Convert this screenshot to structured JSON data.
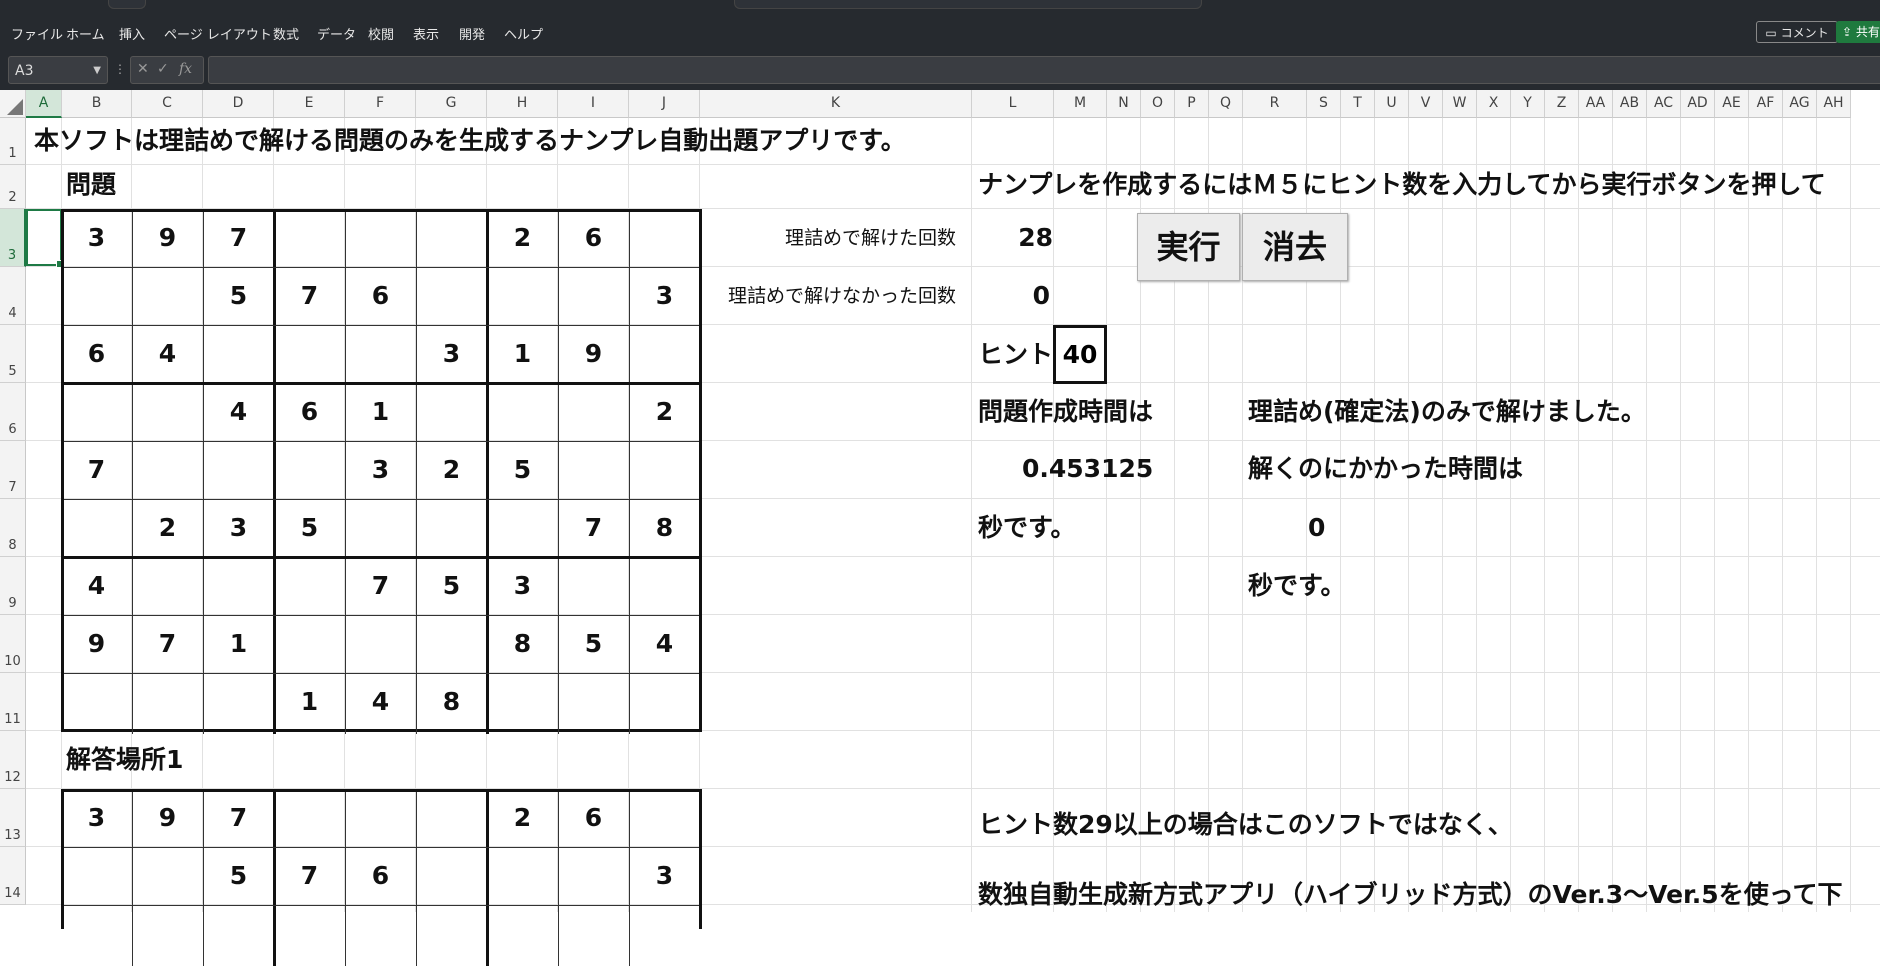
{
  "ribbon": {
    "tabs": [
      "ファイル",
      "ホーム",
      "挿入",
      "ページ レイアウト",
      "数式",
      "データ",
      "校閲",
      "表示",
      "開発",
      "ヘルプ"
    ],
    "comment_label": "コメント",
    "share_label": "共有"
  },
  "formula_bar": {
    "name_box": "A3",
    "formula": ""
  },
  "columns": [
    "A",
    "B",
    "C",
    "D",
    "E",
    "F",
    "G",
    "H",
    "I",
    "J",
    "K",
    "L",
    "M",
    "N",
    "O",
    "P",
    "Q",
    "R",
    "S",
    "T",
    "U",
    "V",
    "W",
    "X",
    "Y",
    "Z",
    "AA",
    "AB",
    "AC",
    "AD",
    "AE",
    "AF",
    "AG",
    "AH"
  ],
  "rows": [
    "1",
    "2",
    "3",
    "4",
    "5",
    "6",
    "7",
    "8",
    "9",
    "10",
    "11",
    "12",
    "13",
    "14"
  ],
  "selected_cell": {
    "column": "A",
    "row": "3"
  },
  "sheet": {
    "title": "本ソフトは理詰めで解ける問題のみを生成するナンプレ自動出題アプリです。",
    "problem_label": "問題",
    "answer_label": "解答場所1",
    "instruction": "ナンプレを作成するにはＭ５にヒント数を入力してから実行ボタンを押して",
    "solved_label": "理詰めで解けた回数",
    "solved_count": "28",
    "unsolved_label": "理詰めで解けなかった回数",
    "unsolved_count": "0",
    "hint_label": "ヒント",
    "hint_value": "40",
    "run_button": "実行",
    "clear_button": "消去",
    "gen_time_label": "問題作成時間は",
    "gen_time_value": "0.453125",
    "gen_time_unit": "秒です。",
    "result_msg": "理詰め(確定法)のみで解けました。",
    "solve_time_label": "解くのにかかった時間は",
    "solve_time_value": "0",
    "solve_time_unit": "秒です。",
    "note1": "ヒント数29以上の場合はこのソフトではなく、",
    "note2": "数独自動生成新方式アプリ（ハイブリッド方式）のVer.3～Ver.5を使って下"
  },
  "puzzle": [
    [
      "3",
      "9",
      "7",
      "",
      "",
      "",
      "2",
      "6",
      ""
    ],
    [
      "",
      "",
      "5",
      "7",
      "6",
      "",
      "",
      "",
      "3"
    ],
    [
      "6",
      "4",
      "",
      "",
      "",
      "3",
      "1",
      "9",
      ""
    ],
    [
      "",
      "",
      "4",
      "6",
      "1",
      "",
      "",
      "",
      "2"
    ],
    [
      "7",
      "",
      "",
      "",
      "3",
      "2",
      "5",
      "",
      ""
    ],
    [
      "",
      "2",
      "3",
      "5",
      "",
      "",
      "",
      "7",
      "8"
    ],
    [
      "4",
      "",
      "",
      "",
      "7",
      "5",
      "3",
      "",
      ""
    ],
    [
      "9",
      "7",
      "1",
      "",
      "",
      "",
      "8",
      "5",
      "4"
    ],
    [
      "",
      "",
      "",
      "1",
      "4",
      "8",
      "",
      "",
      ""
    ]
  ],
  "answer_visible": [
    [
      "3",
      "9",
      "7",
      "",
      "",
      "",
      "2",
      "6",
      ""
    ],
    [
      "",
      "",
      "5",
      "7",
      "6",
      "",
      "",
      "",
      "3"
    ]
  ]
}
